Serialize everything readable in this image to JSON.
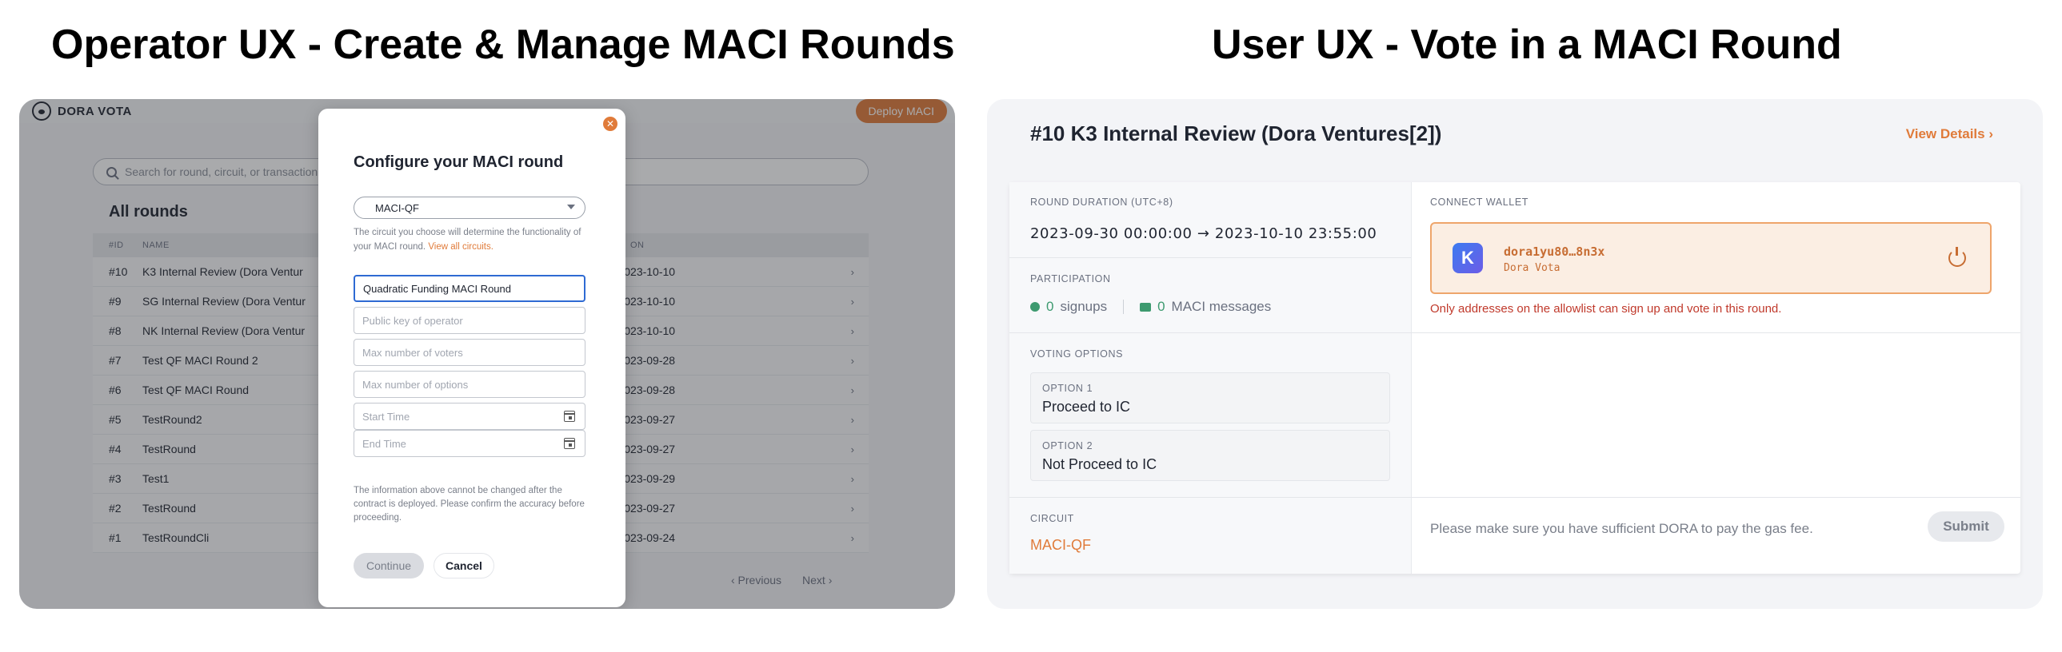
{
  "headings": {
    "left": "Operator UX - Create & Manage MACI Rounds",
    "right": "User UX - Vote in a MACI Round"
  },
  "operator": {
    "brand": "DORA VOTA",
    "deploy_label": "Deploy MACI",
    "search_placeholder": "Search for round, circuit, or transaction",
    "section_title": "All rounds",
    "columns": {
      "id": "#ID",
      "name": "NAME",
      "duration": "ON"
    },
    "rows": [
      {
        "id": "#10",
        "name": "K3 Internal Review (Dora Ventur",
        "dates": "09-30-2023-10-10"
      },
      {
        "id": "#9",
        "name": "SG Internal Review (Dora Ventur",
        "dates": "09-30-2023-10-10"
      },
      {
        "id": "#8",
        "name": "NK Internal Review (Dora Ventur",
        "dates": "09-30-2023-10-10"
      },
      {
        "id": "#7",
        "name": "Test QF MACI Round 2",
        "dates": "09-28-2023-09-28"
      },
      {
        "id": "#6",
        "name": "Test QF MACI Round",
        "dates": "09-28-2023-09-28"
      },
      {
        "id": "#5",
        "name": "TestRound2",
        "dates": "09-27-2023-09-27"
      },
      {
        "id": "#4",
        "name": "TestRound",
        "dates": "09-27-2023-09-27"
      },
      {
        "id": "#3",
        "name": "Test1",
        "dates": "09-26-2023-09-29"
      },
      {
        "id": "#2",
        "name": "TestRound",
        "dates": "09-26-2023-09-27"
      },
      {
        "id": "#1",
        "name": "TestRoundCli",
        "dates": "09-24-2023-09-24"
      }
    ],
    "pager": {
      "prev": "‹ Previous",
      "next": "Next ›"
    },
    "modal": {
      "title": "Configure your MACI round",
      "circuit_selected": "MACI-QF",
      "help_text": "The circuit you choose will determine the functionality of your MACI round.",
      "help_link": "View all circuits.",
      "round_name_value": "Quadratic Funding MACI Round",
      "pubkey_placeholder": "Public key of operator",
      "max_voters_placeholder": "Max number of voters",
      "max_options_placeholder": "Max number of options",
      "start_placeholder": "Start Time",
      "end_placeholder": "End Time",
      "notice": "The information above cannot be changed after the contract is deployed. Please confirm the accuracy before proceeding.",
      "continue_label": "Continue",
      "cancel_label": "Cancel",
      "close_glyph": "✕"
    }
  },
  "user": {
    "round_title": "#10 K3 Internal Review (Dora Ventures[2])",
    "view_details": "View Details ›",
    "duration_label": "ROUND DURATION (UTC+8)",
    "duration_value": "2023-09-30 00:00:00  →  2023-10-10 23:55:00",
    "participation_label": "PARTICIPATION",
    "signups_count": "0",
    "signups_label": "signups",
    "messages_count": "0",
    "messages_label": "MACI messages",
    "voting_label": "VOTING OPTIONS",
    "options": [
      {
        "label": "OPTION 1",
        "text": "Proceed to IC"
      },
      {
        "label": "OPTION 2",
        "text": "Not Proceed to IC"
      }
    ],
    "circuit_label": "CIRCUIT",
    "circuit_value": "MACI-QF",
    "wallet_label": "CONNECT WALLET",
    "wallet_logo": "K",
    "wallet_address": "dora1yu80…8n3x",
    "wallet_name": "Dora Vota",
    "allowlist_msg": "Only addresses on the allowlist can sign up and vote in this round.",
    "gas_msg": "Please make sure you have sufficient DORA to pay the gas fee.",
    "submit_label": "Submit"
  },
  "colors": {
    "accent": "#e07b3a",
    "success": "#3d9a6f",
    "error": "#c0392b"
  }
}
